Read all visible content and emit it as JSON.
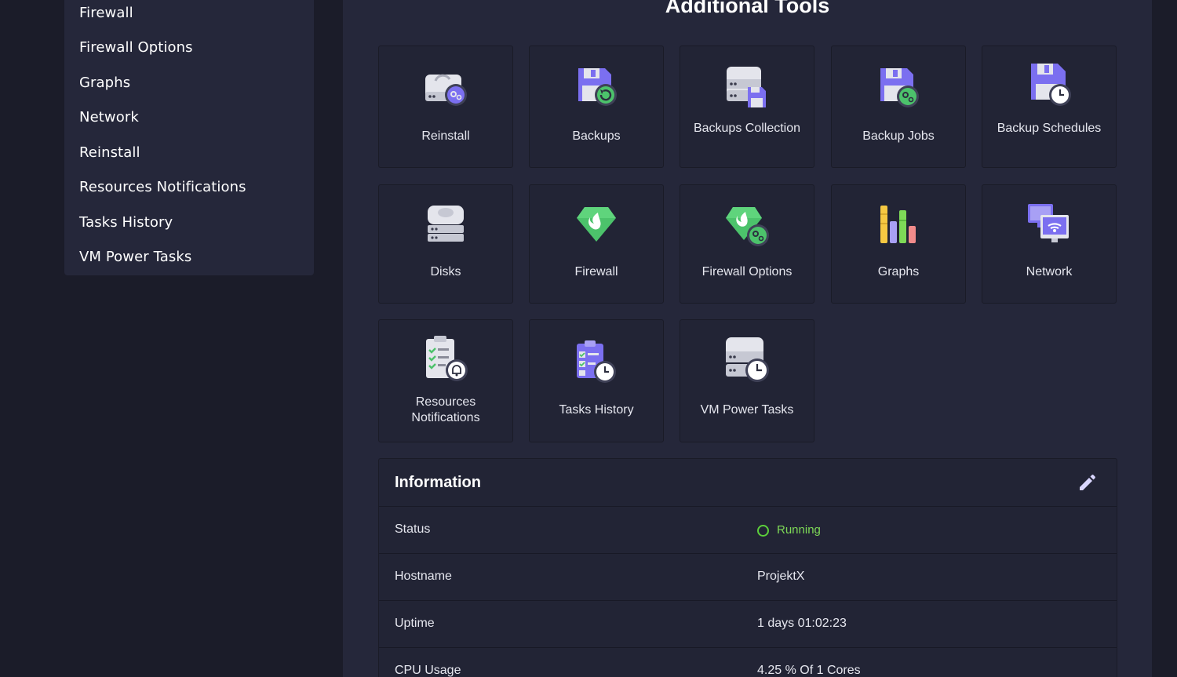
{
  "sidebar": {
    "items": [
      {
        "label": "Firewall"
      },
      {
        "label": "Firewall Options"
      },
      {
        "label": "Graphs"
      },
      {
        "label": "Network"
      },
      {
        "label": "Reinstall"
      },
      {
        "label": "Resources Notifications"
      },
      {
        "label": "Tasks History"
      },
      {
        "label": "VM Power Tasks"
      }
    ]
  },
  "main": {
    "title": "Additional Tools",
    "tools": [
      {
        "label": "Reinstall",
        "icon": "reinstall-icon"
      },
      {
        "label": "Backups",
        "icon": "backups-icon"
      },
      {
        "label": "Backups Collection",
        "icon": "backups-collection-icon"
      },
      {
        "label": "Backup Jobs",
        "icon": "backup-jobs-icon"
      },
      {
        "label": "Backup Schedules",
        "icon": "backup-schedules-icon"
      },
      {
        "label": "Disks",
        "icon": "disks-icon"
      },
      {
        "label": "Firewall",
        "icon": "firewall-icon"
      },
      {
        "label": "Firewall Options",
        "icon": "firewall-options-icon"
      },
      {
        "label": "Graphs",
        "icon": "graphs-icon"
      },
      {
        "label": "Network",
        "icon": "network-icon"
      },
      {
        "label": "Resources Notifications",
        "icon": "resources-notifications-icon"
      },
      {
        "label": "Tasks History",
        "icon": "tasks-history-icon"
      },
      {
        "label": "VM Power Tasks",
        "icon": "vm-power-tasks-icon"
      }
    ]
  },
  "info": {
    "title": "Information",
    "edit_icon": "pencil-icon",
    "rows": [
      {
        "key": "Status",
        "value": "Running"
      },
      {
        "key": "Hostname",
        "value": "ProjektX"
      },
      {
        "key": "Uptime",
        "value": "1 days 01:02:23"
      },
      {
        "key": "CPU Usage",
        "value": "4.25 % Of 1 Cores"
      }
    ]
  },
  "colors": {
    "background": "#1b1c29",
    "panel": "#25273a",
    "tile": "#222435",
    "status_running": "#7ed957",
    "accent_purple": "#7b6ff0",
    "accent_green": "#4cc26b"
  }
}
